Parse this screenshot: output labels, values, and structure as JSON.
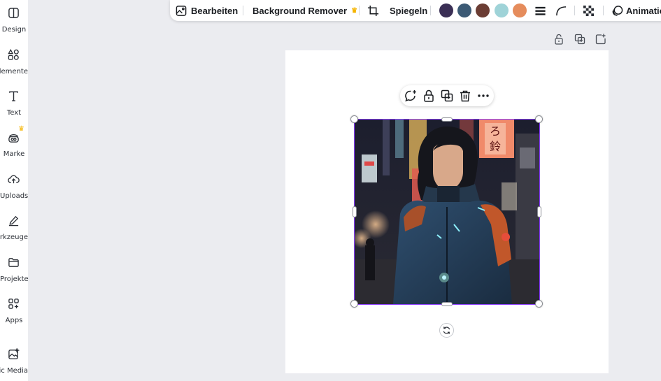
{
  "sidebar": {
    "items": [
      {
        "label": "Design",
        "icon": "layout-icon"
      },
      {
        "label": "Elemente",
        "icon": "shapes-icon"
      },
      {
        "label": "Text",
        "icon": "text-icon"
      },
      {
        "label": "Marke",
        "icon": "brand-icon",
        "badge": "crown"
      },
      {
        "label": "Uploads",
        "icon": "cloud-upload-icon"
      },
      {
        "label": "Werkzeuge",
        "icon": "pen-icon"
      },
      {
        "label": "Projekte",
        "icon": "folder-icon"
      },
      {
        "label": "Apps",
        "icon": "apps-icon"
      },
      {
        "label": "Magic Media",
        "icon": "magic-media-icon"
      }
    ]
  },
  "toolbar": {
    "edit_label": "Bearbeiten",
    "bg_remover_label": "Background Remover",
    "flip_label": "Spiegeln",
    "animate_label": "Animatio",
    "colors": [
      "#3a2f55",
      "#3c5a75",
      "#6b3d34",
      "#9fd3d8",
      "#e58c5c"
    ]
  },
  "accent": "#8b3dff"
}
